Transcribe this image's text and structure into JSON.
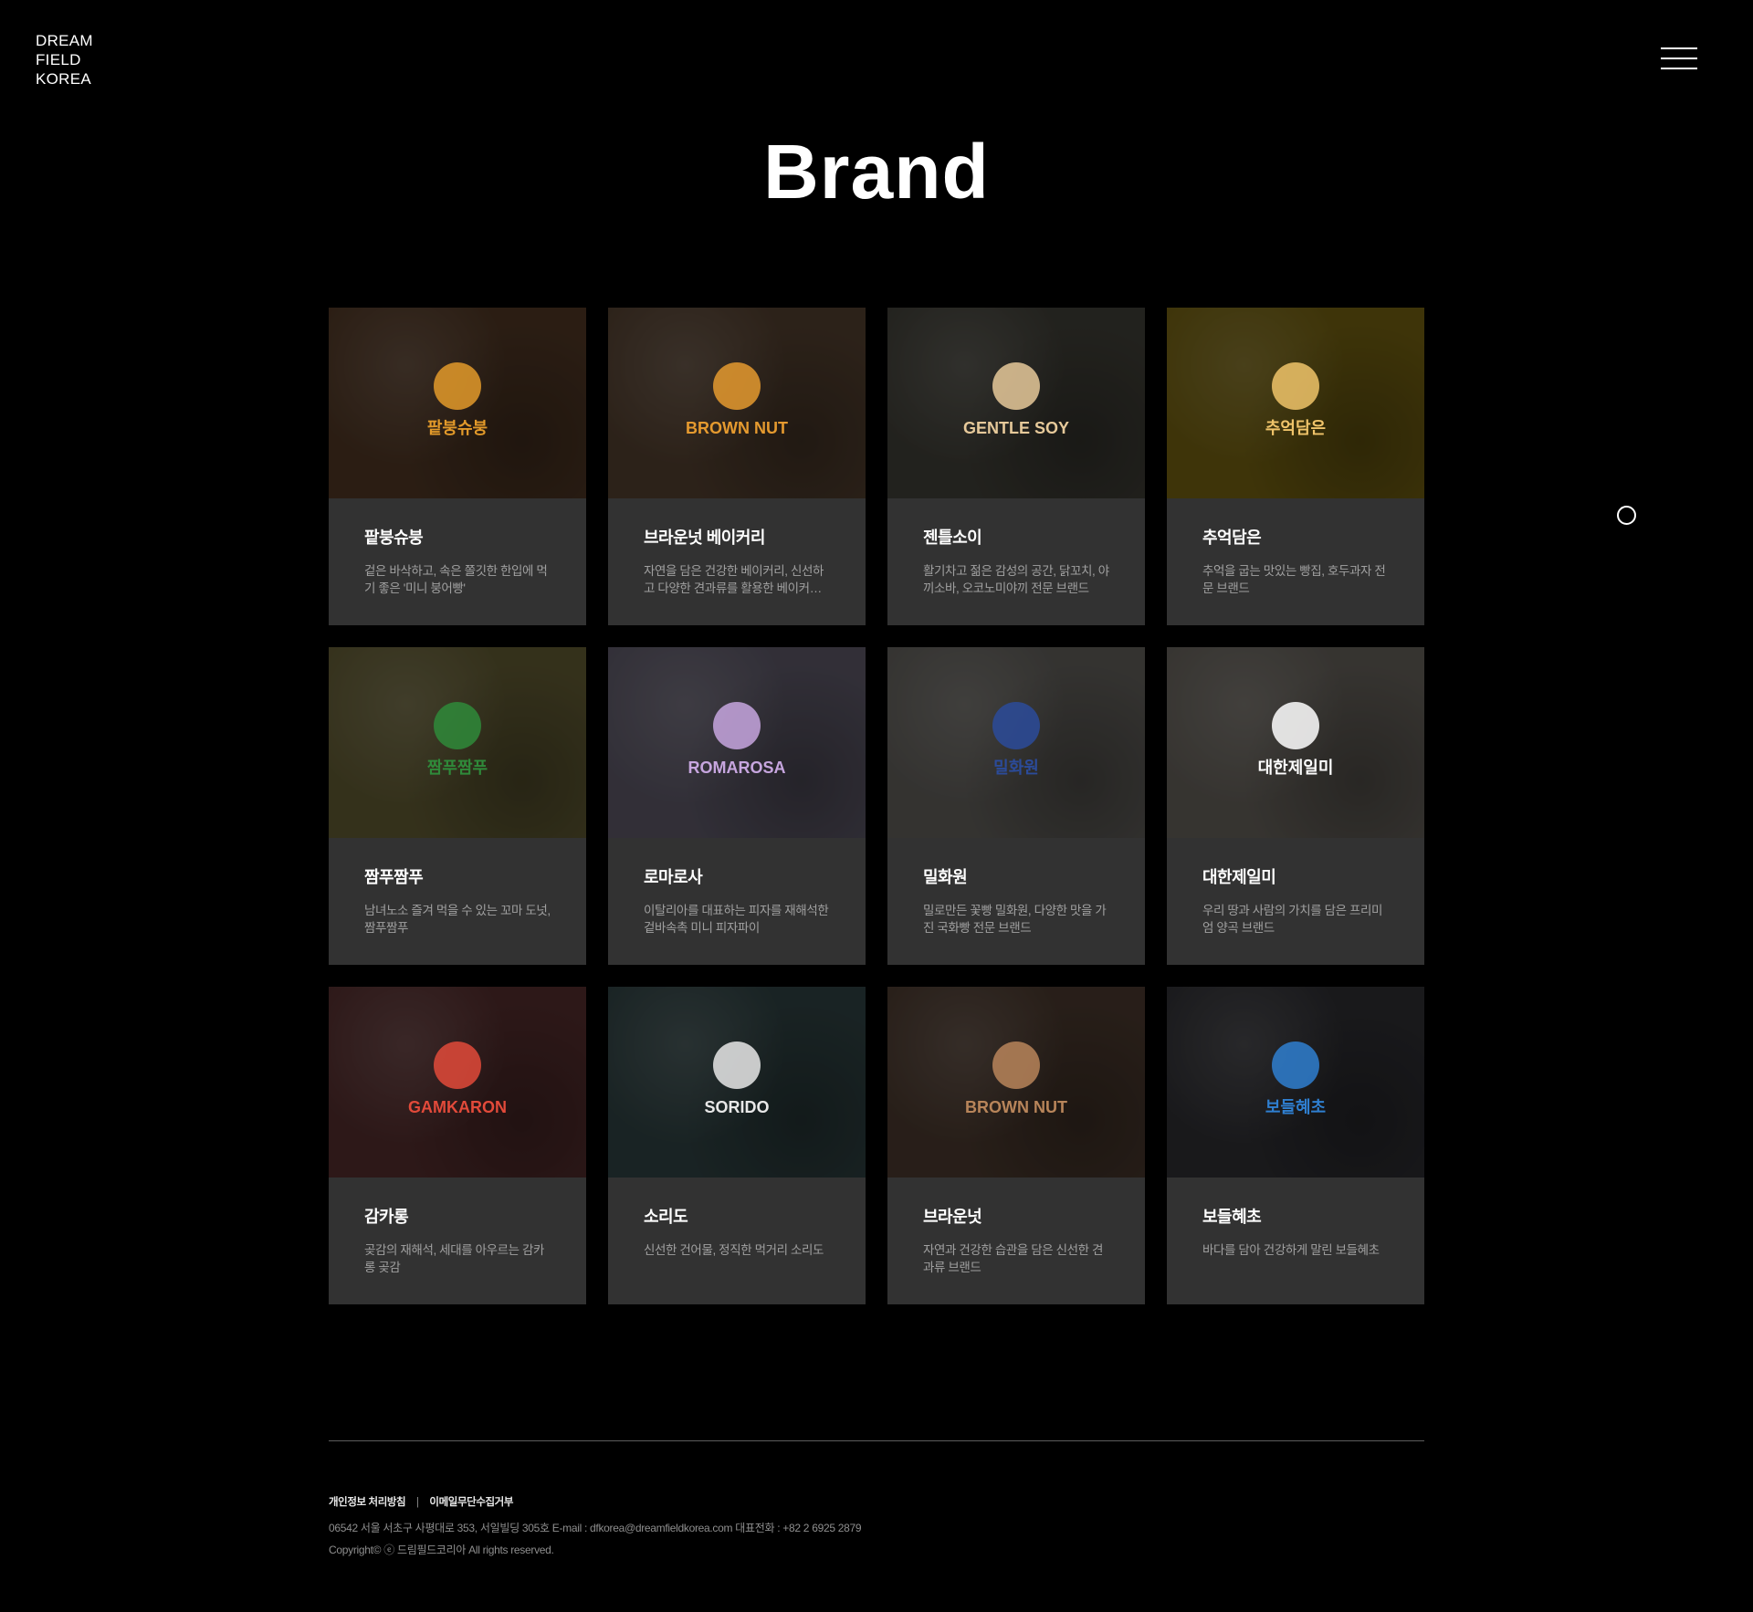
{
  "header": {
    "logo_lines": [
      "DREAM",
      "FIELD",
      "KOREA"
    ],
    "menu_icon": "hamburger-menu-icon"
  },
  "page": {
    "title": "Brand"
  },
  "brands": [
    {
      "name": "팥붕슈붕",
      "desc": "겉은 바삭하고, 속은 쫄깃한 한입에 먹기 좋은 '미니 붕어빵'",
      "bg": "#4a3322",
      "logo_text": "팥붕슈붕",
      "logo_color": "#e39a2a"
    },
    {
      "name": "브라운넛 베이커리",
      "desc": "자연을 담은 건강한 베이커리, 신선하고 다양한 견과류를 활용한 베이커리 브랜드",
      "bg": "#4d3b2c",
      "logo_text": "BROWN NUT",
      "logo_color": "#e59a2f"
    },
    {
      "name": "젠틀소이",
      "desc": "활기차고 젊은 감성의 공간, 닭꼬치, 야끼소바, 오코노미야끼 전문 브랜드",
      "bg": "#3c3b34",
      "logo_text": "GENTLE SOY",
      "logo_color": "#e6c99a"
    },
    {
      "name": "추억담은",
      "desc": "추억을 굽는 맛있는 빵집, 호두과자 전문 브랜드",
      "bg": "#6b5a10",
      "logo_text": "추억담은",
      "logo_color": "#f0c46a"
    },
    {
      "name": "짬푸짬푸",
      "desc": "남녀노소 즐겨 먹을 수 있는 꼬마 도넛, 짬푸짬푸",
      "bg": "#5b5530",
      "logo_text": "짬푸짬푸",
      "logo_color": "#2f8a3a"
    },
    {
      "name": "로마로사",
      "desc": "이탈리아를 대표하는 피자를 재해석한 겉바속촉 미니 피자파이",
      "bg": "#565260",
      "logo_text": "ROMAROSA",
      "logo_color": "#c7a6df"
    },
    {
      "name": "밀화원",
      "desc": "밀로만든 꽃빵 밀화원, 다양한 맛을 가진 국화빵 전문 브랜드",
      "bg": "#5a5854",
      "logo_text": "밀화원",
      "logo_color": "#2b4b9a"
    },
    {
      "name": "대한제일미",
      "desc": "우리 땅과 사람의 가치를 담은 프리미엄 양곡 브랜드",
      "bg": "#5e5a54",
      "logo_text": "대한제일미",
      "logo_color": "#ffffff"
    },
    {
      "name": "감카롱",
      "desc": "곶감의 재해석, 세대를 아우르는 감카롱 곶감",
      "bg": "#4e2a2a",
      "logo_text": "GAMKARON",
      "logo_color": "#e24a3a"
    },
    {
      "name": "소리도",
      "desc": "신선한 건어물, 정직한 먹거리 소리도",
      "bg": "#2c3d3e",
      "logo_text": "SORIDO",
      "logo_color": "#e8e8e8"
    },
    {
      "name": "브라운넛",
      "desc": "자연과 건강한 습관을 담은 신선한 견과류 브랜드",
      "bg": "#45352b",
      "logo_text": "BROWN NUT",
      "logo_color": "#b8855a"
    },
    {
      "name": "보들혜초",
      "desc": "바다를 담아 건강하게 말린 보들혜초",
      "bg": "#2c2c30",
      "logo_text": "보들혜초",
      "logo_color": "#2f7fd0"
    }
  ],
  "footer": {
    "privacy": "개인정보 처리방침",
    "email_refusal": "이메일무단수집거부",
    "address": "06542 서울 서초구 사평대로 353, 서일빌딩 305호  E-mail : dfkorea@dreamfieldkorea.com  대표전화 : +82 2 6925 2879",
    "copyright": "Copyright© ⓔ 드림필드코리아 All rights reserved."
  }
}
